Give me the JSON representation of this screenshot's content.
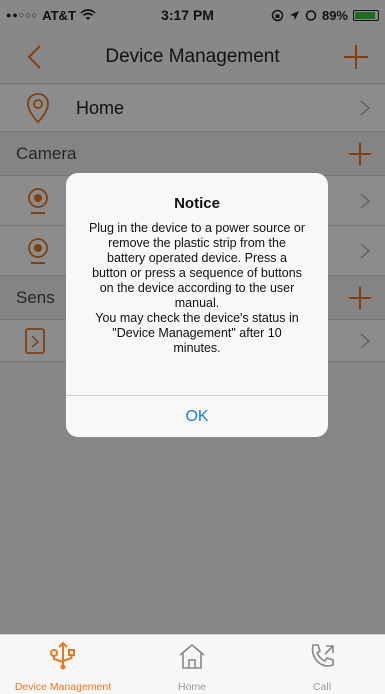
{
  "status_bar": {
    "carrier": "AT&T",
    "time": "3:17 PM",
    "battery": "89%",
    "battery_level": 0.89
  },
  "nav": {
    "title": "Device Management"
  },
  "list": {
    "home_label": "Home",
    "camera_section": "Camera",
    "sensor_section": "Sens"
  },
  "dialog": {
    "title": "Notice",
    "message_lines": [
      "Plug in the device to a power source or",
      "remove the plastic strip from the",
      "battery operated device. Press a",
      "button or press a sequence of buttons",
      "on the device according to the user",
      "manual.",
      "You may check the device's status in",
      "\"Device Management\" after 10",
      "minutes."
    ],
    "ok_label": "OK"
  },
  "tabs": [
    {
      "label": "Device Management",
      "active": true,
      "icon": "usb-icon"
    },
    {
      "label": "Home",
      "active": false,
      "icon": "home-icon"
    },
    {
      "label": "Call",
      "active": false,
      "icon": "phone-icon"
    }
  ],
  "colors": {
    "accent": "#e87722",
    "link": "#1a7cf2",
    "battery": "#3cc341"
  }
}
